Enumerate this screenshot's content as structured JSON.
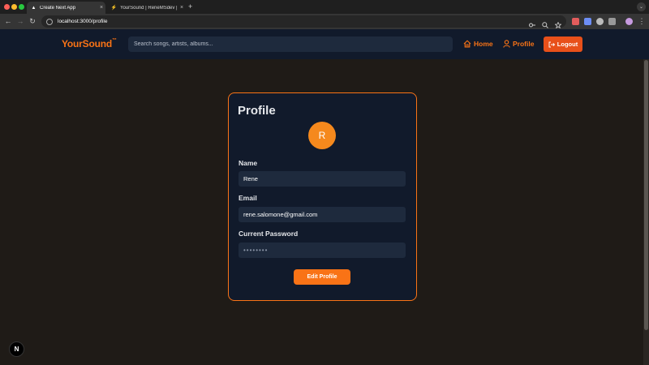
{
  "browser": {
    "tabs": [
      {
        "title": "Create Next App",
        "favicon": "next-triangle-icon",
        "active": true
      },
      {
        "title": "YourSound | ReneMSdev | Su...",
        "favicon": "vercel-icon",
        "active": false
      }
    ],
    "new_tab_label": "+",
    "url": "localhost:3000/profile"
  },
  "app": {
    "logo": "YourSound",
    "logo_mark": "™",
    "search_placeholder": "Search songs, artists, albums...",
    "nav": {
      "home": "Home",
      "profile": "Profile",
      "logout": "Logout"
    },
    "colors": {
      "accent": "#f97316",
      "header_bg": "#111a2b",
      "page_bg": "#1f1b17"
    }
  },
  "profile": {
    "title": "Profile",
    "avatar_initial": "R",
    "name_label": "Name",
    "name_value": "Rene",
    "email_label": "Email",
    "email_value": "rene.salomone@gmail.com",
    "password_label": "Current Password",
    "password_value": "••••••••",
    "edit_button": "Edit Profile"
  },
  "dev_badge": "N"
}
